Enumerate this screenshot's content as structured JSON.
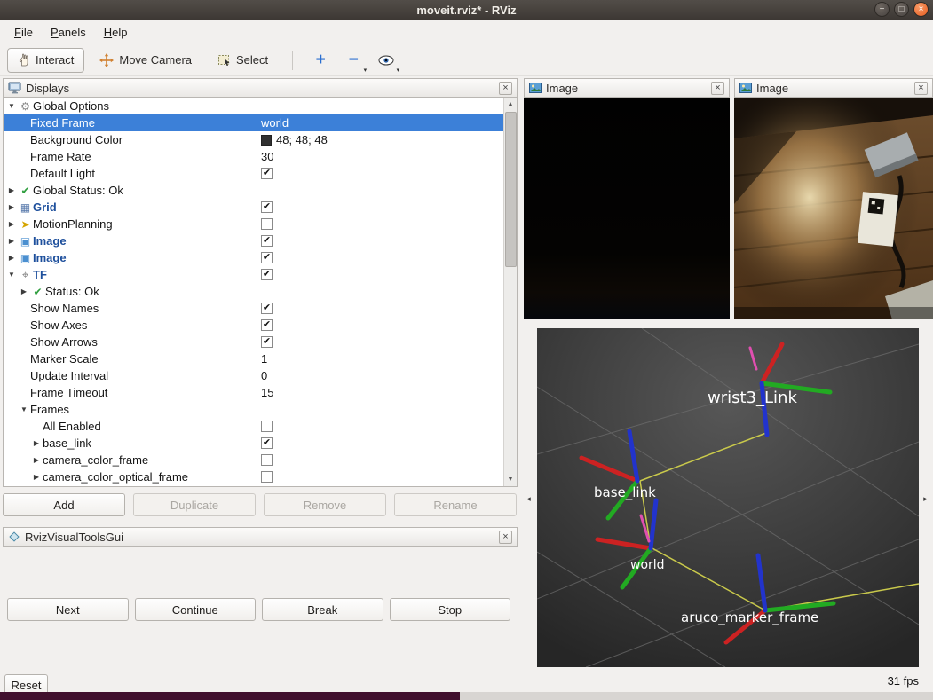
{
  "window": {
    "title": "moveit.rviz* - RViz"
  },
  "menu": {
    "items": [
      {
        "label": "File"
      },
      {
        "label": "Panels"
      },
      {
        "label": "Help"
      }
    ]
  },
  "toolbar": {
    "interact_label": "Interact",
    "move_camera_label": "Move Camera",
    "select_label": "Select"
  },
  "icons": {
    "close": "×",
    "window_minimize": "−",
    "window_maximize": "□",
    "plus": "+",
    "minus": "−",
    "caret_down": "▾",
    "expander_down": "▼",
    "expander_right": "▶",
    "scroll_up": "▲",
    "scroll_down": "▼",
    "panel_collapse_left": "◂",
    "panel_collapse_right": "▸",
    "check": "✔",
    "tree": {
      "gear": "⚙",
      "check": "✔",
      "grid": "▦",
      "motion": "➤",
      "image": "▣",
      "tf": "⌖"
    }
  },
  "displays_panel": {
    "title": "Displays",
    "rows": [
      {
        "indent": 0,
        "expander": "down",
        "icon": "gear",
        "label": "Global Options"
      },
      {
        "indent": 1,
        "label": "Fixed Frame",
        "value": "world",
        "selected": true
      },
      {
        "indent": 1,
        "label": "Background Color",
        "value": "48; 48; 48",
        "swatch": "#303030"
      },
      {
        "indent": 1,
        "label": "Frame Rate",
        "value": "30"
      },
      {
        "indent": 1,
        "label": "Default Light",
        "checkbox": true,
        "checked": true
      },
      {
        "indent": 0,
        "expander": "right",
        "icon": "check",
        "label": "Global Status: Ok"
      },
      {
        "indent": 0,
        "expander": "right",
        "icon": "grid",
        "label": "Grid",
        "bold": true,
        "checkbox": true,
        "checked": true
      },
      {
        "indent": 0,
        "expander": "right",
        "icon": "motion",
        "label": "MotionPlanning",
        "checkbox": true,
        "checked": false
      },
      {
        "indent": 0,
        "expander": "right",
        "icon": "image",
        "label": "Image",
        "bold": true,
        "checkbox": true,
        "checked": true
      },
      {
        "indent": 0,
        "expander": "right",
        "icon": "image",
        "label": "Image",
        "bold": true,
        "checkbox": true,
        "checked": true
      },
      {
        "indent": 0,
        "expander": "down",
        "icon": "tf",
        "label": "TF",
        "bold": true,
        "checkbox": true,
        "checked": true
      },
      {
        "indent": 1,
        "expander": "right",
        "icon": "check",
        "label": "Status: Ok"
      },
      {
        "indent": 1,
        "label": "Show Names",
        "checkbox": true,
        "checked": true
      },
      {
        "indent": 1,
        "label": "Show Axes",
        "checkbox": true,
        "checked": true
      },
      {
        "indent": 1,
        "label": "Show Arrows",
        "checkbox": true,
        "checked": true
      },
      {
        "indent": 1,
        "label": "Marker Scale",
        "value": "1"
      },
      {
        "indent": 1,
        "label": "Update Interval",
        "value": "0"
      },
      {
        "indent": 1,
        "label": "Frame Timeout",
        "value": "15"
      },
      {
        "indent": 1,
        "expander": "down",
        "label": "Frames"
      },
      {
        "indent": 2,
        "label": "All Enabled",
        "checkbox": true,
        "checked": false
      },
      {
        "indent": 2,
        "expander": "right",
        "label": "base_link",
        "checkbox": true,
        "checked": true
      },
      {
        "indent": 2,
        "expander": "right",
        "label": "camera_color_frame",
        "checkbox": true,
        "checked": false
      },
      {
        "indent": 2,
        "expander": "right",
        "label": "camera_color_optical_frame",
        "checkbox": true,
        "checked": false
      }
    ],
    "buttons": [
      {
        "label": "Add",
        "enabled": true
      },
      {
        "label": "Duplicate",
        "enabled": false
      },
      {
        "label": "Remove",
        "enabled": false
      },
      {
        "label": "Rename",
        "enabled": false
      }
    ]
  },
  "visual_tools_panel": {
    "title": "RvizVisualToolsGui",
    "buttons": [
      {
        "label": "Next",
        "enabled": true
      },
      {
        "label": "Continue",
        "enabled": true
      },
      {
        "label": "Break",
        "enabled": true
      },
      {
        "label": "Stop",
        "enabled": true
      }
    ]
  },
  "reset_label": "Reset",
  "image_panels": [
    {
      "title": "Image"
    },
    {
      "title": "Image"
    }
  ],
  "view3d": {
    "fps": "31 fps",
    "frames": [
      {
        "label": "wrist3_Link"
      },
      {
        "label": "base_link"
      },
      {
        "label": "world"
      },
      {
        "label": "aruco_marker_frame"
      }
    ],
    "colors": {
      "x_axis": "#cc2222",
      "y_axis": "#22aa22",
      "z_axis": "#2233cc",
      "connection": "#c9c94b",
      "arrow": "#e04fb0",
      "background": "#3d3d3d"
    }
  },
  "colors": {
    "selection": "#3c80d8",
    "display_enabled_text": "#1d4f9c"
  }
}
